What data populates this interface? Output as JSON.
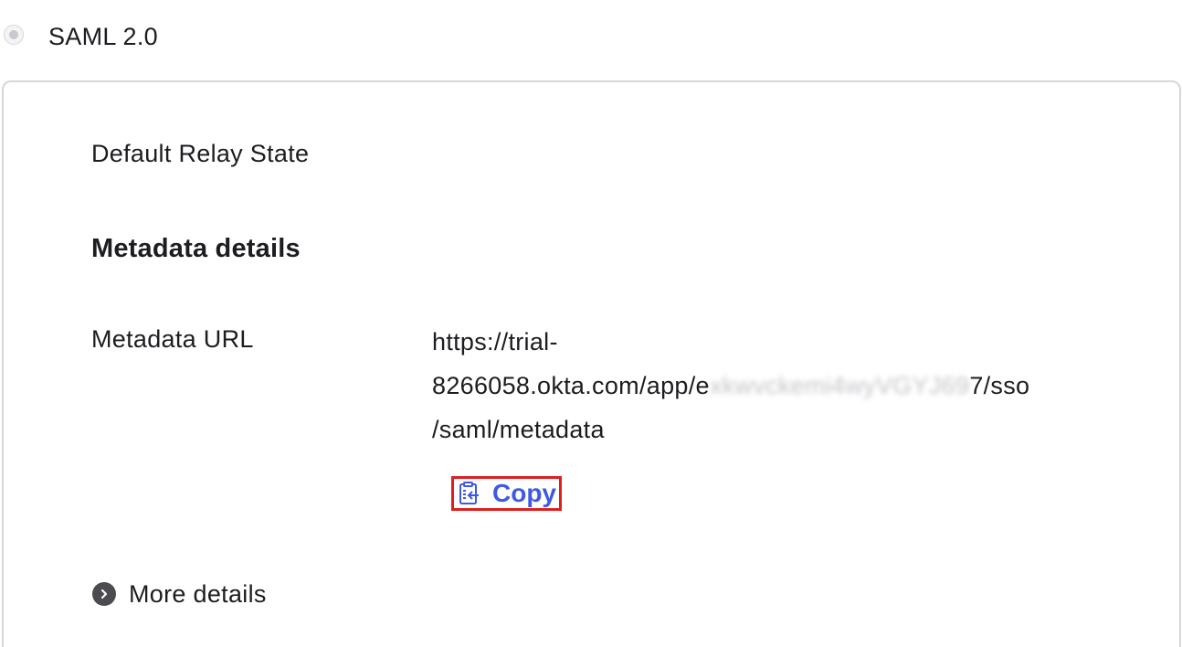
{
  "sign_on_method": {
    "label": "SAML 2.0",
    "selected": true
  },
  "panel": {
    "relay_state_label": "Default Relay State",
    "section_heading": "Metadata details",
    "metadata_url_label": "Metadata URL",
    "metadata_url_lines": {
      "line1": "https://trial-",
      "line2_prefix": "8266058.okta.com/app/e",
      "line2_redacted": "xkwvckemi4wyVGYJ69",
      "line2_suffix": "7/sso",
      "line3": "/saml/metadata"
    },
    "copy_label": "Copy",
    "more_details_label": "More details"
  },
  "colors": {
    "accent": "#3f59e4",
    "highlight_border": "#e01e1e",
    "text": "#1d1d21",
    "panel_border": "#d7d7dc"
  },
  "icons": {
    "copy": "clipboard-icon",
    "more": "chevron-right-circle-icon",
    "radio": "radio-button"
  }
}
